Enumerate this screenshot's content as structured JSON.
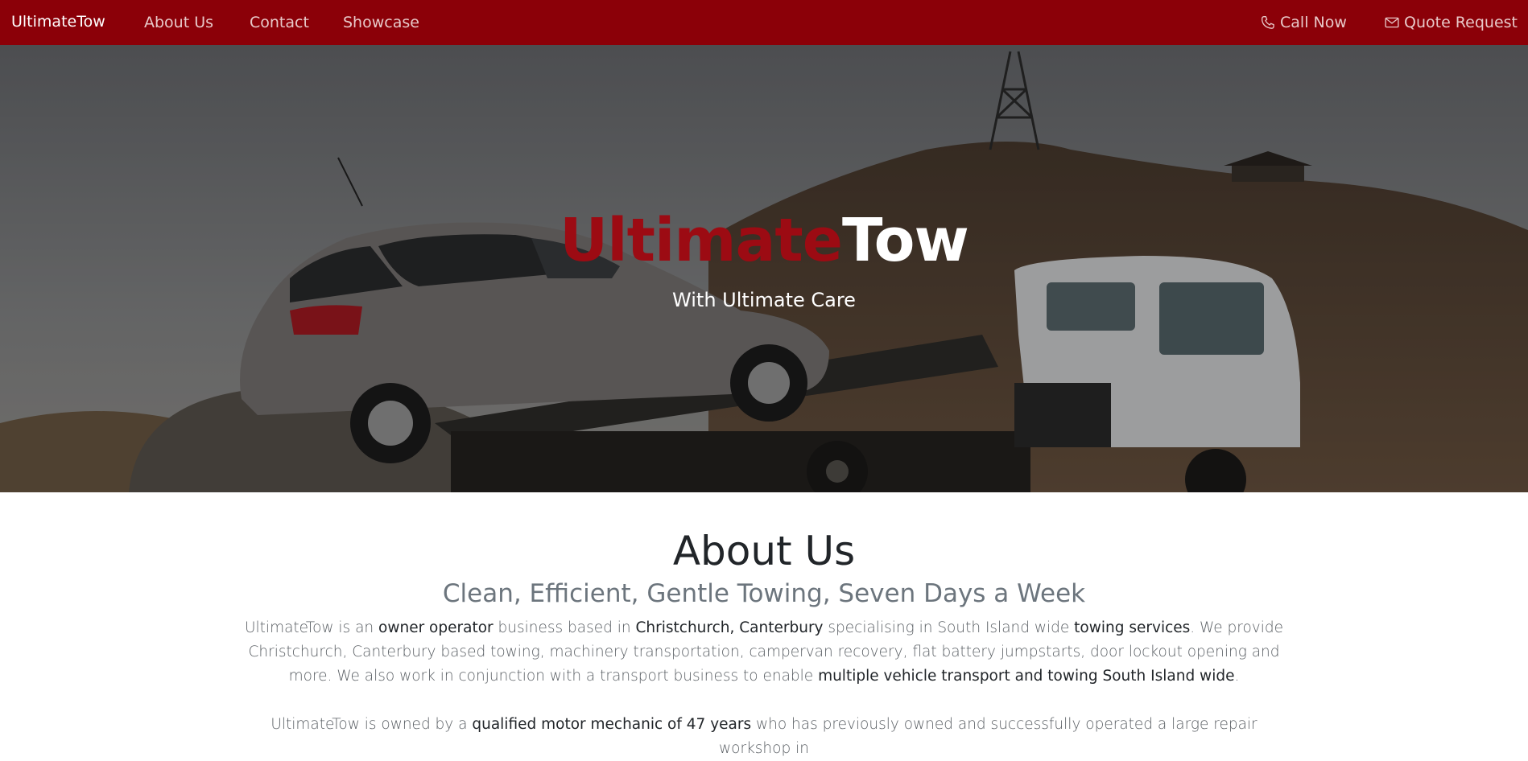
{
  "nav": {
    "brand": "UltimateTow",
    "links": [
      "About Us",
      "Contact",
      "Showcase"
    ],
    "call_now": "Call Now",
    "quote_request": "Quote Request",
    "background_color": "#8b0008"
  },
  "hero": {
    "title_red": "Ultimate",
    "title_white": "Tow",
    "subtitle": "With Ultimate Care",
    "title_red_color": "#9c0b13"
  },
  "about": {
    "title": "About Us",
    "subtitle": "Clean, Efficient, Gentle Towing, Seven Days a Week",
    "p1": [
      "UltimateTow is an ",
      "owner operator",
      " business based in ",
      "Christchurch, Canterbury",
      " specialising in South Island wide ",
      "towing services",
      ". We provide Christchurch, Canterbury based towing, machinery transportation, campervan recovery, flat battery jumpstarts, door lockout opening and more. We also work in conjunction with a transport business to enable ",
      "multiple vehicle transport and towing South Island wide",
      "."
    ],
    "p2": [
      "UltimateTow is owned by a ",
      "qualified motor mechanic of 47 years",
      " who has previously owned and successfully operated a large repair workshop in"
    ]
  }
}
